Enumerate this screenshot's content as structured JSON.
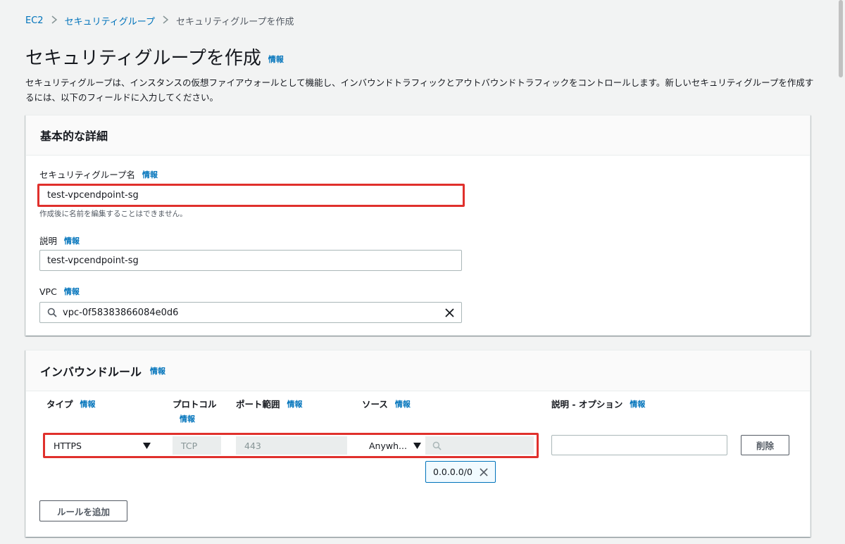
{
  "breadcrumb": {
    "ec2": "EC2",
    "security_groups": "セキュリティグループ",
    "current": "セキュリティグループを作成"
  },
  "page": {
    "title": "セキュリティグループを作成",
    "info": "情報",
    "description": "セキュリティグループは、インスタンスの仮想ファイアウォールとして機能し、インバウンドトラフィックとアウトバウンドトラフィックをコントロールします。新しいセキュリティグループを作成するには、以下のフィールドに入力してください。"
  },
  "basic": {
    "title": "基本的な詳細",
    "name_label": "セキュリティグループ名",
    "name_value": "test-vpcendpoint-sg",
    "name_hint": "作成後に名前を編集することはできません。",
    "desc_label": "説明",
    "desc_value": "test-vpcendpoint-sg",
    "vpc_label": "VPC",
    "vpc_value": "vpc-0f58383866084e0d6",
    "info": "情報"
  },
  "inbound": {
    "title": "インバウンドルール",
    "info": "情報",
    "columns": {
      "type": "タイプ",
      "protocol": "プロトコル",
      "port_range": "ポート範囲",
      "source": "ソース",
      "description": "説明 - オプション"
    },
    "rule": {
      "type": "HTTPS",
      "protocol": "TCP",
      "port": "443",
      "source": "Anywh...",
      "cidr": "0.0.0.0/0",
      "description": ""
    },
    "delete_label": "削除",
    "add_rule_label": "ルールを追加"
  },
  "icons": {
    "separator": ">",
    "dropdown": "▼",
    "close": "✕"
  },
  "colors": {
    "link": "#0073bb",
    "highlight": "#e0302c",
    "background": "#f2f3f3"
  }
}
